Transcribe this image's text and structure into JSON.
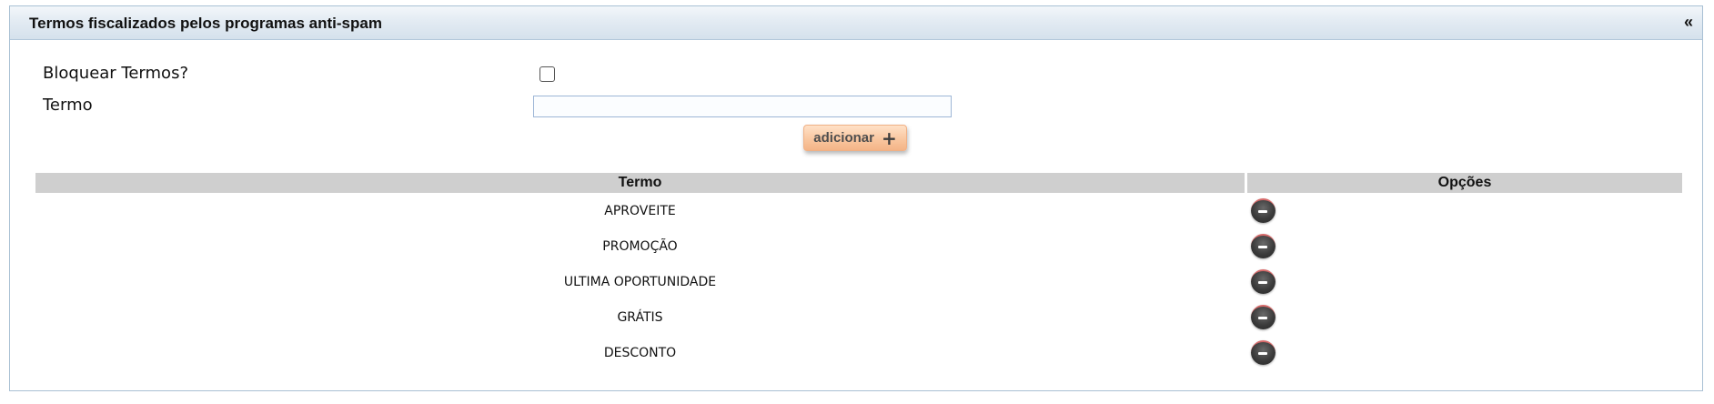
{
  "panel": {
    "title": "Termos fiscalizados pelos programas anti-spam",
    "collapse_label": "«"
  },
  "form": {
    "block_label": "Bloquear Termos?",
    "block_checked": false,
    "term_label": "Termo",
    "term_value": "",
    "add_label": "adicionar"
  },
  "table": {
    "headers": [
      "Termo",
      "Opções"
    ],
    "rows": [
      {
        "term": "APROVEITE"
      },
      {
        "term": "PROMOÇÃO"
      },
      {
        "term": "ULTIMA OPORTUNIDADE"
      },
      {
        "term": "GRÁTIS"
      },
      {
        "term": "DESCONTO"
      }
    ]
  },
  "icons": {
    "add": "plus-icon",
    "remove": "remove-minus-icon",
    "collapse": "double-chevron-left-icon"
  },
  "colors": {
    "header_gradient_top": "#f2f6fa",
    "header_gradient_bottom": "#d5e1ec",
    "panel_border": "#a9c0d4",
    "button_orange": "#f9c7a0",
    "table_header_gray": "#cfcfcf"
  }
}
